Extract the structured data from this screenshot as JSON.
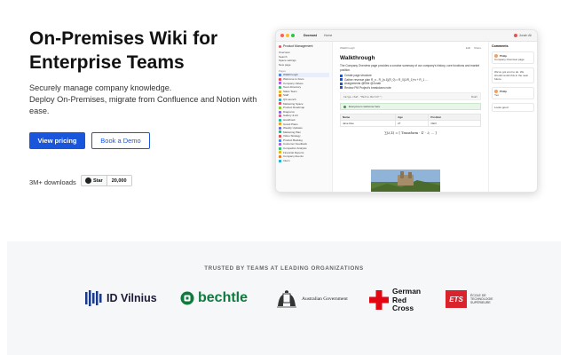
{
  "hero": {
    "headline": "On-Premises Wiki for Enterprise Teams",
    "subtitle_line1": "Securely manage company knowledge.",
    "subtitle_line2": "Deploy On-Premises, migrate from Confluence and Notion with ease.",
    "primary_button": "View pricing",
    "secondary_button": "Book a Demo",
    "downloads": "3M+ downloads",
    "github_star_label": "Star",
    "github_star_count": "20,000"
  },
  "app": {
    "brand": "Docmost",
    "tab": "Home",
    "user": "Jonah Ali",
    "workspace": "Product Management",
    "sidebar_top": [
      "Overview",
      "Search",
      "Space settings",
      "New page"
    ],
    "sidebar_group": "Pages",
    "sidebar_pages": [
      {
        "label": "Walkthrough",
        "color": "#3b82f6"
      },
      {
        "label": "Welcome to Docs",
        "color": "#ef4444"
      },
      {
        "label": "Company Values",
        "color": "#a855f7"
      },
      {
        "label": "Team Directory",
        "color": "#22c55e"
      },
      {
        "label": "Sales Team",
        "color": "#eab308"
      },
      {
        "label": "Staff",
        "color": "#f97316"
      },
      {
        "label": "Q3 Launch",
        "color": "#06b6d4"
      },
      {
        "label": "Marketing Space",
        "color": "#f43f5e"
      },
      {
        "label": "Product Roadmap",
        "color": "#84cc16"
      },
      {
        "label": "Diagrams",
        "color": "#8b5cf6"
      },
      {
        "label": "Gallery & Art",
        "color": "#ec4899"
      },
      {
        "label": "Handbook",
        "color": "#14b8a6"
      },
      {
        "label": "Grand Plans",
        "color": "#f59e0b"
      },
      {
        "label": "Weekly Updates",
        "color": "#6366f1"
      },
      {
        "label": "Marketing Plan",
        "color": "#10b981"
      },
      {
        "label": "Video Strategy",
        "color": "#ef4444"
      },
      {
        "label": "Product Backlog",
        "color": "#3b82f6"
      },
      {
        "label": "Customer Feedback",
        "color": "#a855f7"
      },
      {
        "label": "Competitor Analysis",
        "color": "#22c55e"
      },
      {
        "label": "Financial Reports",
        "color": "#eab308"
      },
      {
        "label": "Company Events",
        "color": "#f97316"
      },
      {
        "label": "Intern",
        "color": "#06b6d4"
      }
    ],
    "breadcrumb": "Walkthrough",
    "toolbar": [
      "Edit",
      "Share"
    ],
    "page_title": "Walkthrough",
    "intro": "The Company Overview page provides a concise summary of our company's history, core functions and market position.",
    "tasks": [
      "Create page structure",
      "Gather revenue plan  R_n - R_{n-1}(R_0) = R_0(1/R_1)^n + R_1 ...",
      "Assignments @Ellie @Jonah",
      "Review PM Project's breakdown note"
    ],
    "code_line": "Cargo.chat \"Hello World!\";",
    "code_lang": "Rust",
    "callout": "Everyone is welcome here",
    "table_headers": [
      "Name",
      "Age",
      "Position"
    ],
    "table_rows": [
      [
        "Jane Doe",
        "27",
        "CEO"
      ]
    ],
    "formula": "∑(∂,Σ) = [ Transform · Σ' · ∂, ... ]",
    "comments_title": "Comments",
    "comments": [
      {
        "author": "Philip",
        "text": "Company Overview page"
      },
      {
        "author": "",
        "text": "We've got a lot to do. We should revisit this in the near future."
      },
      {
        "author": "Philip",
        "text": "Yes"
      },
      {
        "author": "",
        "text": "Looks good"
      }
    ]
  },
  "trusted": {
    "label": "TRUSTED BY TEAMS AT LEADING ORGANIZATIONS",
    "logos": {
      "idv": "ID Vilnius",
      "bechtle": "bechtle",
      "aus": "Australian Government",
      "gr_line1": "German",
      "gr_line2": "Red",
      "gr_line3": "Cross",
      "ets": "ETS",
      "ets_text": "ÉCOLE DE TECHNOLOGIE SUPÉRIEURE"
    }
  },
  "colors": {
    "primary": "#1a56db",
    "trusted_bg": "#f6f7f9",
    "bechtle_green": "#0e7a3d",
    "red_cross": "#e30613",
    "ets_red": "#d9232d"
  }
}
